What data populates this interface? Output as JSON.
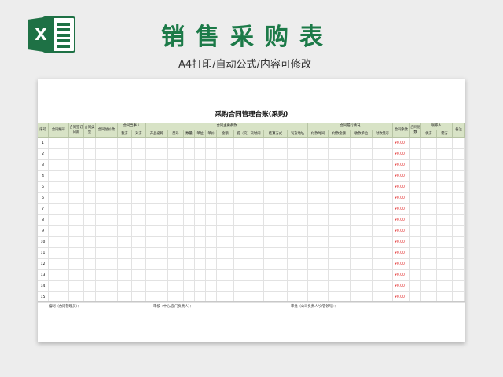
{
  "header": {
    "logo_letter": "X",
    "title": "销售采购表",
    "subtitle": "A4打印/自动公式/内容可修改"
  },
  "sheet": {
    "title": "采购合同管理台账(采购)",
    "groups": {
      "signer": "合同当事人",
      "main_terms": "合同主要条款",
      "performance": "合同履行情况",
      "contact": "联系人"
    },
    "columns": {
      "seq": "序号",
      "contract_no": "合同编号",
      "sign_date": "合同签订日期",
      "contract_type": "合同类型",
      "total_price": "合同总价款",
      "our_side": "我方",
      "other_side": "对方",
      "product": "产品名称",
      "model": "型号",
      "qty": "数量",
      "unit": "单位",
      "unit_price": "单价",
      "amount": "金额",
      "delivery_time": "提（交）货时间",
      "settlement": "结算方式",
      "ship_addr": "发货地址",
      "pay_time": "付款时间",
      "pay_amount": "付款金额",
      "payee": "收款单位",
      "voucher": "付款凭号",
      "balance": "合同余款",
      "copies": "合同份数",
      "supplier": "供方",
      "demander": "需方",
      "remark": "备注"
    },
    "rows": [
      {
        "seq": "1",
        "balance": "¥0.00"
      },
      {
        "seq": "2",
        "balance": "¥0.00"
      },
      {
        "seq": "3",
        "balance": "¥0.00"
      },
      {
        "seq": "4",
        "balance": "¥0.00"
      },
      {
        "seq": "5",
        "balance": "¥0.00"
      },
      {
        "seq": "6",
        "balance": "¥0.00"
      },
      {
        "seq": "7",
        "balance": "¥0.00"
      },
      {
        "seq": "8",
        "balance": "¥0.00"
      },
      {
        "seq": "9",
        "balance": "¥0.00"
      },
      {
        "seq": "10",
        "balance": "¥0.00"
      },
      {
        "seq": "11",
        "balance": "¥0.00"
      },
      {
        "seq": "12",
        "balance": "¥0.00"
      },
      {
        "seq": "13",
        "balance": "¥0.00"
      },
      {
        "seq": "14",
        "balance": "¥0.00"
      },
      {
        "seq": "15",
        "balance": "¥0.00"
      }
    ],
    "footer": {
      "prepared": "编制（合同管理员）：",
      "reviewed": "审核（中心/部门负责人）：",
      "approved": "审批（公司负责人/分管领导）："
    }
  },
  "colors": {
    "brand_green": "#1c7a48",
    "header_fill": "#d8e3c6",
    "balance_red": "#e02020"
  }
}
